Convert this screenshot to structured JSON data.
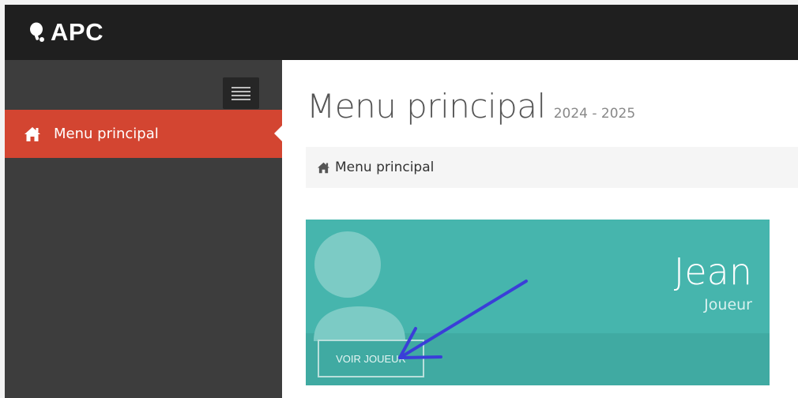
{
  "app": {
    "brand": "APC",
    "logo_icon": "ping-pong-paddle-icon"
  },
  "sidebar": {
    "toggle_icon": "hamburger-menu-icon",
    "items": [
      {
        "label": "Menu principal",
        "icon": "home-icon",
        "active": true
      }
    ]
  },
  "page": {
    "title": "Menu principal",
    "subtitle": "2024 - 2025"
  },
  "breadcrumb": {
    "items": [
      {
        "label": "Menu principal",
        "icon": "home-icon"
      }
    ]
  },
  "card": {
    "name": "Jean",
    "role": "Joueur",
    "button_label": "VOIR JOUEUR",
    "avatar_icon": "user-silhouette-icon"
  },
  "colors": {
    "topbar": "#1f1f1f",
    "sidebar": "#3d3d3d",
    "active_item": "#d34531",
    "card": "#46b5ad",
    "card_footer": "#40aaa2",
    "annotation_arrow": "#3a3ed8"
  }
}
